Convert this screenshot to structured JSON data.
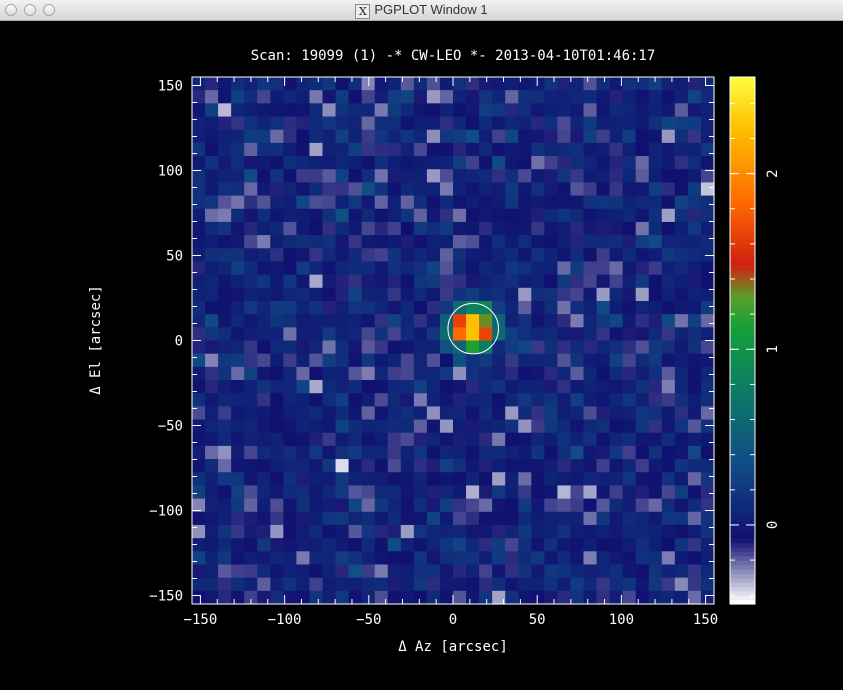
{
  "window": {
    "title": "PGPLOT Window 1",
    "x_icon": "X"
  },
  "plot": {
    "title": "Scan: 19099 (1) -* CW-LEO *- 2013-04-10T01:46:17",
    "xlabel": "Δ Az [arcsec]",
    "ylabel": "Δ El [arcsec]"
  },
  "chart_data": {
    "type": "heatmap",
    "x_range": [
      -155,
      155
    ],
    "y_range": [
      -155,
      155
    ],
    "x_ticks": [
      "−150",
      "−100",
      "−50",
      "0",
      "50",
      "100",
      "150"
    ],
    "y_ticks": [
      "150",
      "100",
      "50",
      "0",
      "−50",
      "−100",
      "−150"
    ],
    "colorbar": {
      "range": [
        -0.45,
        2.55
      ],
      "tick_labels": [
        "0",
        "1",
        "2"
      ],
      "colors": [
        "#ffffff",
        "#101070",
        "#114a86",
        "#0b7a66",
        "#14a038",
        "#5aa02a",
        "#d02010",
        "#ff6a00",
        "#ffc000",
        "#ffff40"
      ]
    },
    "source": {
      "az": 12,
      "el": 7,
      "peak": 2.5,
      "fwhm": 22
    },
    "beam_circle": {
      "az": 12,
      "el": 7,
      "radius": 15
    },
    "grid_cells": 40
  }
}
